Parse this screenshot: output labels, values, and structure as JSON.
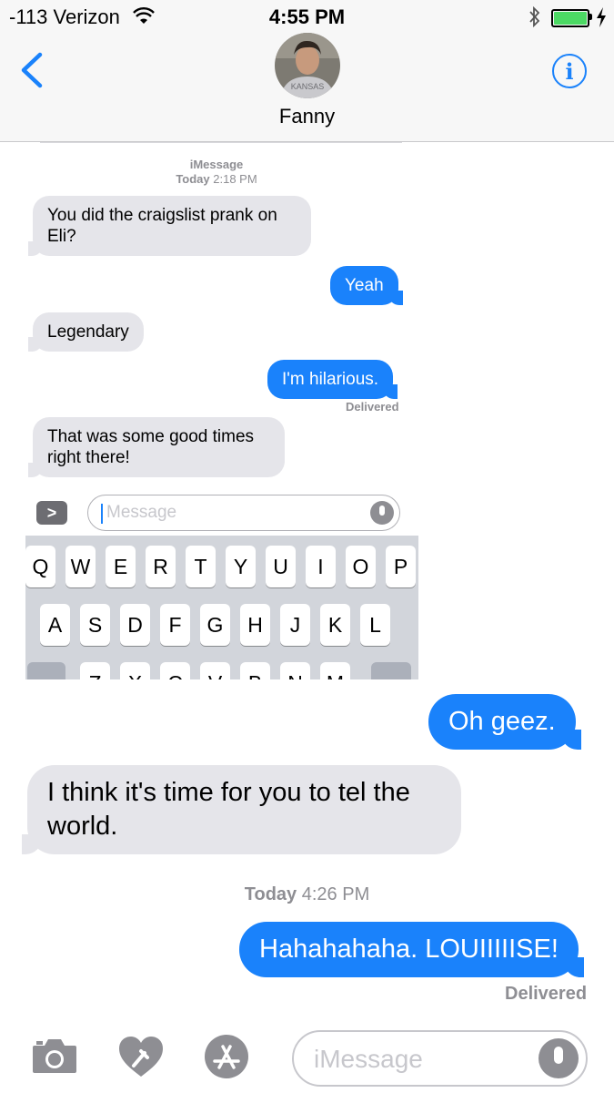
{
  "status_bar": {
    "carrier": "-113 Verizon",
    "time": "4:55 PM",
    "battery_level": 1.0
  },
  "header": {
    "contact_name": "Fanny",
    "avatar_caption": "KANSAS",
    "info_label": "i"
  },
  "embedded_screenshot": {
    "service_label": "iMessage",
    "timestamp_day": "Today",
    "timestamp_time": "2:18 PM",
    "messages": [
      {
        "from": "them",
        "text_line1": "You did the craigslist prank on",
        "text_line2": "Eli?"
      },
      {
        "from": "me",
        "text": "Yeah"
      },
      {
        "from": "them",
        "text": "Legendary"
      },
      {
        "from": "me",
        "text": "I'm hilarious."
      },
      {
        "from": "them",
        "text_line1": "That was some good times",
        "text_line2": "right there!"
      }
    ],
    "delivered_label": "Delivered",
    "input_placeholder": "Message",
    "expand_label": ">",
    "keyboard_row1": [
      "Q",
      "W",
      "E",
      "R",
      "T",
      "Y",
      "U",
      "I",
      "O",
      "P"
    ],
    "keyboard_row2": [
      "A",
      "S",
      "D",
      "F",
      "G",
      "H",
      "J",
      "K",
      "L"
    ],
    "keyboard_row3": [
      "Z",
      "X",
      "C",
      "V",
      "B",
      "N",
      "M"
    ]
  },
  "conversation": {
    "messages": [
      {
        "from": "me",
        "text": "Oh geez."
      },
      {
        "from": "them",
        "text_line1": "I think it's time for you to tel the",
        "text_line2": "world."
      },
      {
        "from": "me",
        "text": "Hahahahaha. LOUIIIIISE!"
      }
    ],
    "timestamp_day": "Today",
    "timestamp_time": "4:26 PM",
    "delivered_label": "Delivered"
  },
  "input_bar": {
    "placeholder": "iMessage"
  },
  "icons": [
    "back-chevron-icon",
    "info-icon",
    "wifi-icon",
    "bluetooth-icon",
    "battery-icon",
    "charging-bolt-icon",
    "camera-icon",
    "digital-touch-heart-icon",
    "app-store-icon",
    "microphone-icon"
  ],
  "colors": {
    "accent": "#1a82fb",
    "received_bubble": "#e5e5ea",
    "meta_text": "#8e8e93",
    "battery_fill": "#4cd964"
  }
}
